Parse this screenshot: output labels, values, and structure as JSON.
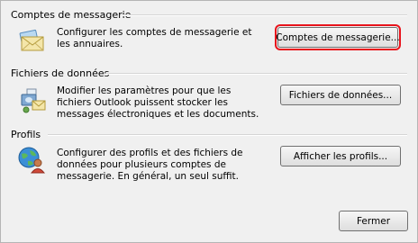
{
  "sections": {
    "mail": {
      "title": "Comptes de messagerie",
      "description": "Configurer les comptes de messagerie et les annuaires.",
      "button": "Comptes de messagerie..."
    },
    "data": {
      "title": "Fichiers de données",
      "description": "Modifier les paramètres pour que les fichiers Outlook puissent stocker les messages électroniques et les documents.",
      "button": "Fichiers de données..."
    },
    "profiles": {
      "title": "Profils",
      "description": "Configurer des profils et des fichiers de données pour plusieurs comptes de messagerie. En général, un seul suffit.",
      "button": "Afficher les profils..."
    }
  },
  "footer": {
    "close_label": "Fermer"
  },
  "colors": {
    "highlight": "#e8141c"
  },
  "icons": {
    "mail": "envelope-mail-icon",
    "data": "data-files-icon",
    "profiles": "globe-user-profiles-icon"
  }
}
